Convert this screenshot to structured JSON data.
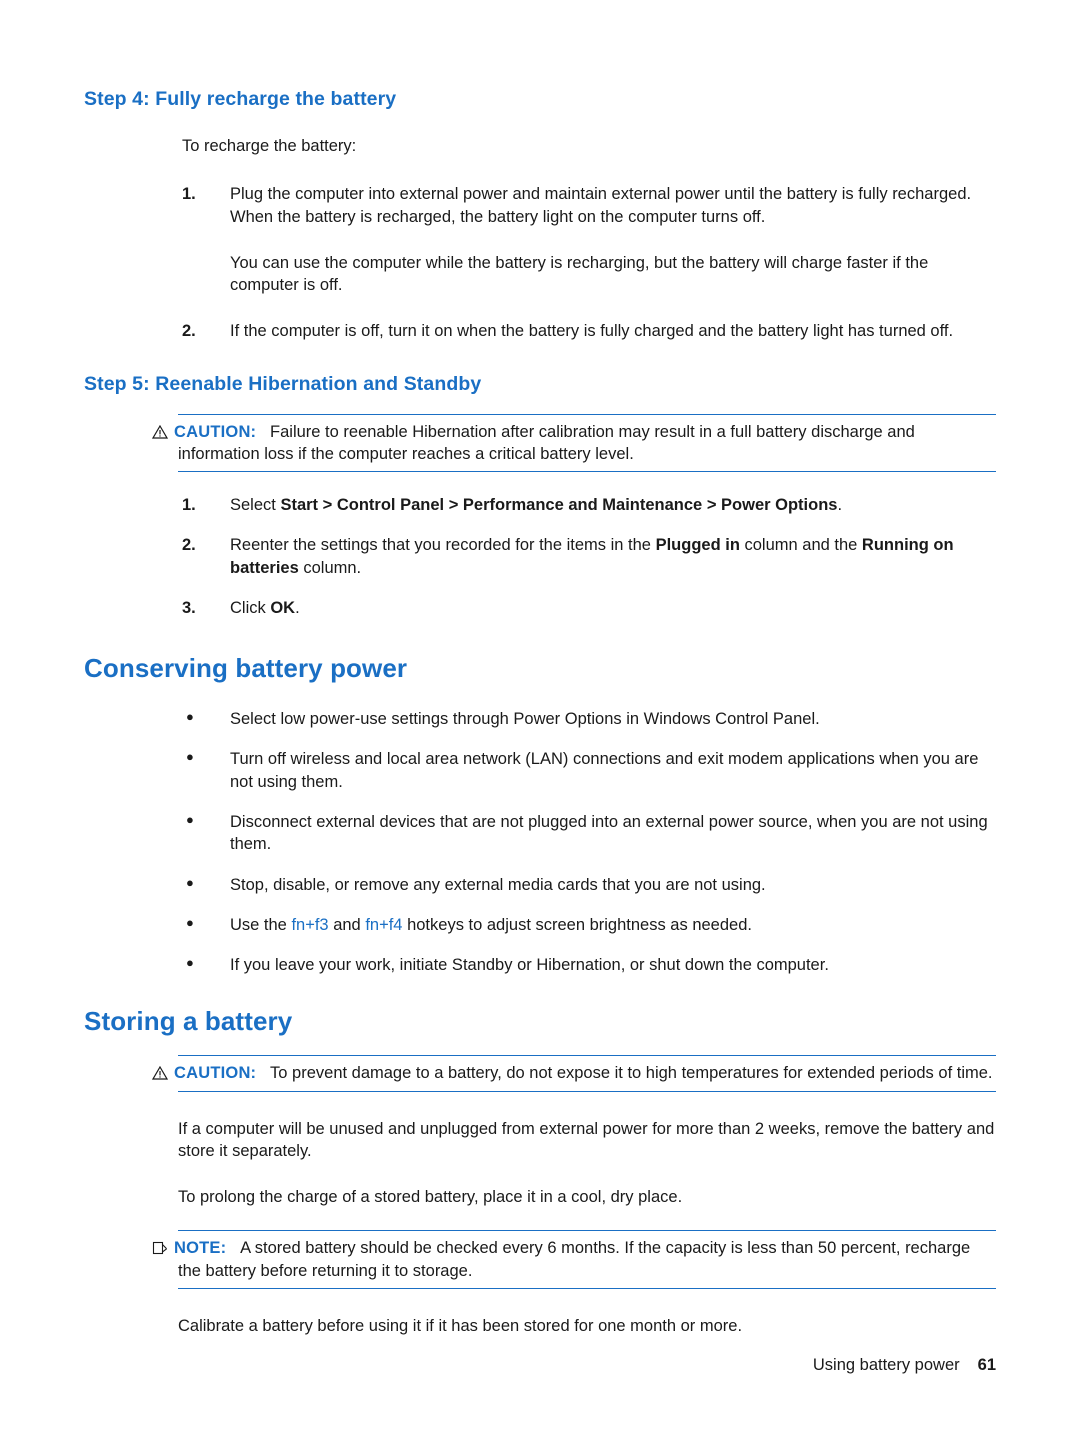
{
  "document": {
    "step4": {
      "heading": "Step 4: Fully recharge the battery",
      "intro": "To recharge the battery:",
      "items": [
        {
          "num": "1.",
          "text": "Plug the computer into external power and maintain external power until the battery is fully recharged. When the battery is recharged, the battery light on the computer turns off."
        },
        {
          "num": "2.",
          "text": "If the computer is off, turn it on when the battery is fully charged and the battery light has turned off."
        }
      ],
      "note_between": "You can use the computer while the battery is recharging, but the battery will charge faster if the computer is off."
    },
    "step5": {
      "heading": "Step 5: Reenable Hibernation and Standby",
      "caution": {
        "icon": "caution-triangle-icon",
        "label": "CAUTION:",
        "text": "Failure to reenable Hibernation after calibration may result in a full battery discharge and information loss if the computer reaches a critical battery level."
      },
      "items": [
        {
          "num": "1.",
          "parts": [
            {
              "t": "Select ",
              "b": false
            },
            {
              "t": "Start > Control Panel > Performance and Maintenance > Power Options",
              "b": true
            },
            {
              "t": ".",
              "b": false
            }
          ]
        },
        {
          "num": "2.",
          "parts": [
            {
              "t": "Reenter the settings that you recorded for the items in the ",
              "b": false
            },
            {
              "t": "Plugged in",
              "b": true
            },
            {
              "t": " column and the ",
              "b": false
            },
            {
              "t": "Running on batteries",
              "b": true
            },
            {
              "t": " column.",
              "b": false
            }
          ]
        },
        {
          "num": "3.",
          "parts": [
            {
              "t": "Click ",
              "b": false
            },
            {
              "t": "OK",
              "b": true
            },
            {
              "t": ".",
              "b": false
            }
          ]
        }
      ]
    },
    "conserving": {
      "heading": "Conserving battery power",
      "bullets": [
        {
          "parts": [
            {
              "t": "Select low power-use settings through Power Options in Windows Control Panel.",
              "k": "n"
            }
          ]
        },
        {
          "parts": [
            {
              "t": "Turn off wireless and local area network (LAN) connections and exit modem applications when you are not using them.",
              "k": "n"
            }
          ]
        },
        {
          "parts": [
            {
              "t": "Disconnect external devices that are not plugged into an external power source, when you are not using them.",
              "k": "n"
            }
          ]
        },
        {
          "parts": [
            {
              "t": "Stop, disable, or remove any external media cards that you are not using.",
              "k": "n"
            }
          ]
        },
        {
          "parts": [
            {
              "t": "Use the ",
              "k": "n"
            },
            {
              "t": "fn+f3",
              "k": "link"
            },
            {
              "t": " and ",
              "k": "n"
            },
            {
              "t": "fn+f4",
              "k": "link"
            },
            {
              "t": " hotkeys to adjust screen brightness as needed.",
              "k": "n"
            }
          ]
        },
        {
          "parts": [
            {
              "t": "If you leave your work, initiate Standby or Hibernation, or shut down the computer.",
              "k": "n"
            }
          ]
        }
      ]
    },
    "storing": {
      "heading": "Storing a battery",
      "caution": {
        "icon": "caution-triangle-icon",
        "label": "CAUTION:",
        "text": "To prevent damage to a battery, do not expose it to high temperatures for extended periods of time."
      },
      "para1": "If a computer will be unused and unplugged from external power for more than 2 weeks, remove the battery and store it separately.",
      "para2": "To prolong the charge of a stored battery, place it in a cool, dry place.",
      "note": {
        "icon": "note-pencil-icon",
        "label": "NOTE:",
        "text": "A stored battery should be checked every 6 months. If the capacity is less than 50 percent, recharge the battery before returning it to storage."
      },
      "para3": "Calibrate a battery before using it if it has been stored for one month or more."
    },
    "footer": {
      "chapter": "Using battery power",
      "page": "61"
    },
    "colors": {
      "accent": "#1a6fc4",
      "text": "#1a1a1a"
    }
  }
}
